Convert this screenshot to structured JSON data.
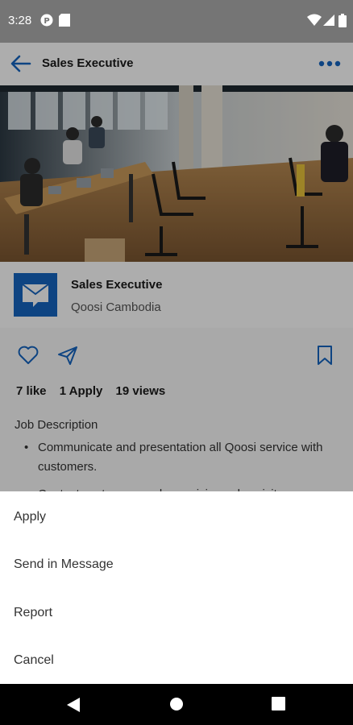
{
  "status_bar": {
    "time": "3:28"
  },
  "app_bar": {
    "title": "Sales Executive"
  },
  "job": {
    "title": "Sales Executive",
    "company": "Qoosi Cambodia"
  },
  "stats": {
    "likes": "7 like",
    "applies": "1 Apply",
    "views": "19 views"
  },
  "description": {
    "heading": "Job Description",
    "bullets": [
      "Communicate and presentation all Qoosi service with customers.",
      "Contact customers and organizing sales visit"
    ]
  },
  "bottom_sheet": {
    "items": [
      {
        "label": "Apply"
      },
      {
        "label": "Send in Message"
      },
      {
        "label": "Report"
      },
      {
        "label": "Cancel"
      }
    ]
  },
  "colors": {
    "accent": "#1565c0",
    "status_bar": "#757575",
    "scrim": "rgba(0,0,0,0.32)"
  }
}
